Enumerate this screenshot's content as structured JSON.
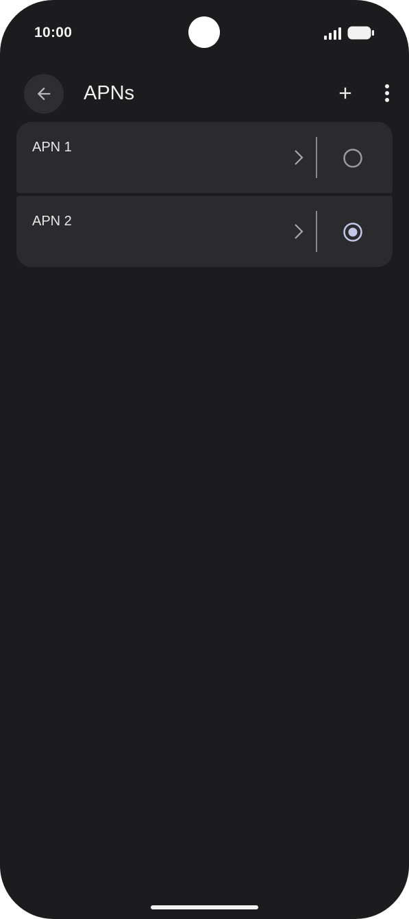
{
  "status_bar": {
    "time": "10:00"
  },
  "toolbar": {
    "title": "APNs",
    "back_icon": "arrow-back-icon",
    "add_icon": "plus-icon",
    "more_icon": "more-vert-icon"
  },
  "apns": [
    {
      "name": "APN 1",
      "selected": false
    },
    {
      "name": "APN 2",
      "selected": true
    }
  ],
  "colors": {
    "background": "#1c1c1e",
    "card": "#2b2b2e",
    "radio_selected": "#c3c7e6",
    "radio_unselected": "#9a9a9e"
  }
}
